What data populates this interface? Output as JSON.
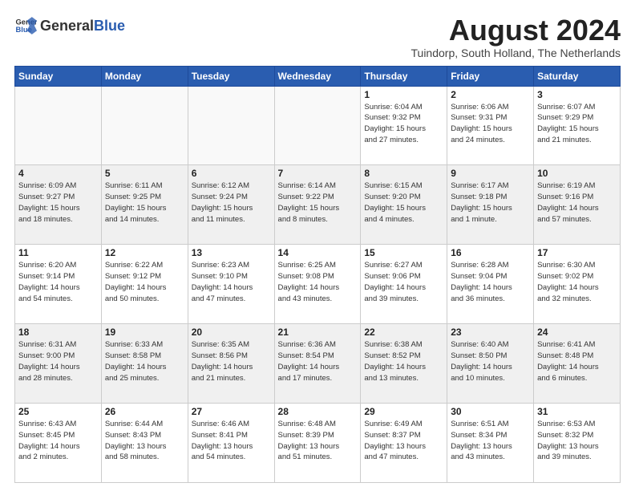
{
  "header": {
    "logo_general": "General",
    "logo_blue": "Blue",
    "month_title": "August 2024",
    "location": "Tuindorp, South Holland, The Netherlands"
  },
  "weekdays": [
    "Sunday",
    "Monday",
    "Tuesday",
    "Wednesday",
    "Thursday",
    "Friday",
    "Saturday"
  ],
  "weeks": [
    [
      {
        "day": "",
        "info": "",
        "empty": true
      },
      {
        "day": "",
        "info": "",
        "empty": true
      },
      {
        "day": "",
        "info": "",
        "empty": true
      },
      {
        "day": "",
        "info": "",
        "empty": true
      },
      {
        "day": "1",
        "info": "Sunrise: 6:04 AM\nSunset: 9:32 PM\nDaylight: 15 hours\nand 27 minutes."
      },
      {
        "day": "2",
        "info": "Sunrise: 6:06 AM\nSunset: 9:31 PM\nDaylight: 15 hours\nand 24 minutes."
      },
      {
        "day": "3",
        "info": "Sunrise: 6:07 AM\nSunset: 9:29 PM\nDaylight: 15 hours\nand 21 minutes."
      }
    ],
    [
      {
        "day": "4",
        "info": "Sunrise: 6:09 AM\nSunset: 9:27 PM\nDaylight: 15 hours\nand 18 minutes."
      },
      {
        "day": "5",
        "info": "Sunrise: 6:11 AM\nSunset: 9:25 PM\nDaylight: 15 hours\nand 14 minutes."
      },
      {
        "day": "6",
        "info": "Sunrise: 6:12 AM\nSunset: 9:24 PM\nDaylight: 15 hours\nand 11 minutes."
      },
      {
        "day": "7",
        "info": "Sunrise: 6:14 AM\nSunset: 9:22 PM\nDaylight: 15 hours\nand 8 minutes."
      },
      {
        "day": "8",
        "info": "Sunrise: 6:15 AM\nSunset: 9:20 PM\nDaylight: 15 hours\nand 4 minutes."
      },
      {
        "day": "9",
        "info": "Sunrise: 6:17 AM\nSunset: 9:18 PM\nDaylight: 15 hours\nand 1 minute."
      },
      {
        "day": "10",
        "info": "Sunrise: 6:19 AM\nSunset: 9:16 PM\nDaylight: 14 hours\nand 57 minutes."
      }
    ],
    [
      {
        "day": "11",
        "info": "Sunrise: 6:20 AM\nSunset: 9:14 PM\nDaylight: 14 hours\nand 54 minutes."
      },
      {
        "day": "12",
        "info": "Sunrise: 6:22 AM\nSunset: 9:12 PM\nDaylight: 14 hours\nand 50 minutes."
      },
      {
        "day": "13",
        "info": "Sunrise: 6:23 AM\nSunset: 9:10 PM\nDaylight: 14 hours\nand 47 minutes."
      },
      {
        "day": "14",
        "info": "Sunrise: 6:25 AM\nSunset: 9:08 PM\nDaylight: 14 hours\nand 43 minutes."
      },
      {
        "day": "15",
        "info": "Sunrise: 6:27 AM\nSunset: 9:06 PM\nDaylight: 14 hours\nand 39 minutes."
      },
      {
        "day": "16",
        "info": "Sunrise: 6:28 AM\nSunset: 9:04 PM\nDaylight: 14 hours\nand 36 minutes."
      },
      {
        "day": "17",
        "info": "Sunrise: 6:30 AM\nSunset: 9:02 PM\nDaylight: 14 hours\nand 32 minutes."
      }
    ],
    [
      {
        "day": "18",
        "info": "Sunrise: 6:31 AM\nSunset: 9:00 PM\nDaylight: 14 hours\nand 28 minutes."
      },
      {
        "day": "19",
        "info": "Sunrise: 6:33 AM\nSunset: 8:58 PM\nDaylight: 14 hours\nand 25 minutes."
      },
      {
        "day": "20",
        "info": "Sunrise: 6:35 AM\nSunset: 8:56 PM\nDaylight: 14 hours\nand 21 minutes."
      },
      {
        "day": "21",
        "info": "Sunrise: 6:36 AM\nSunset: 8:54 PM\nDaylight: 14 hours\nand 17 minutes."
      },
      {
        "day": "22",
        "info": "Sunrise: 6:38 AM\nSunset: 8:52 PM\nDaylight: 14 hours\nand 13 minutes."
      },
      {
        "day": "23",
        "info": "Sunrise: 6:40 AM\nSunset: 8:50 PM\nDaylight: 14 hours\nand 10 minutes."
      },
      {
        "day": "24",
        "info": "Sunrise: 6:41 AM\nSunset: 8:48 PM\nDaylight: 14 hours\nand 6 minutes."
      }
    ],
    [
      {
        "day": "25",
        "info": "Sunrise: 6:43 AM\nSunset: 8:45 PM\nDaylight: 14 hours\nand 2 minutes."
      },
      {
        "day": "26",
        "info": "Sunrise: 6:44 AM\nSunset: 8:43 PM\nDaylight: 13 hours\nand 58 minutes."
      },
      {
        "day": "27",
        "info": "Sunrise: 6:46 AM\nSunset: 8:41 PM\nDaylight: 13 hours\nand 54 minutes."
      },
      {
        "day": "28",
        "info": "Sunrise: 6:48 AM\nSunset: 8:39 PM\nDaylight: 13 hours\nand 51 minutes."
      },
      {
        "day": "29",
        "info": "Sunrise: 6:49 AM\nSunset: 8:37 PM\nDaylight: 13 hours\nand 47 minutes."
      },
      {
        "day": "30",
        "info": "Sunrise: 6:51 AM\nSunset: 8:34 PM\nDaylight: 13 hours\nand 43 minutes."
      },
      {
        "day": "31",
        "info": "Sunrise: 6:53 AM\nSunset: 8:32 PM\nDaylight: 13 hours\nand 39 minutes."
      }
    ]
  ]
}
